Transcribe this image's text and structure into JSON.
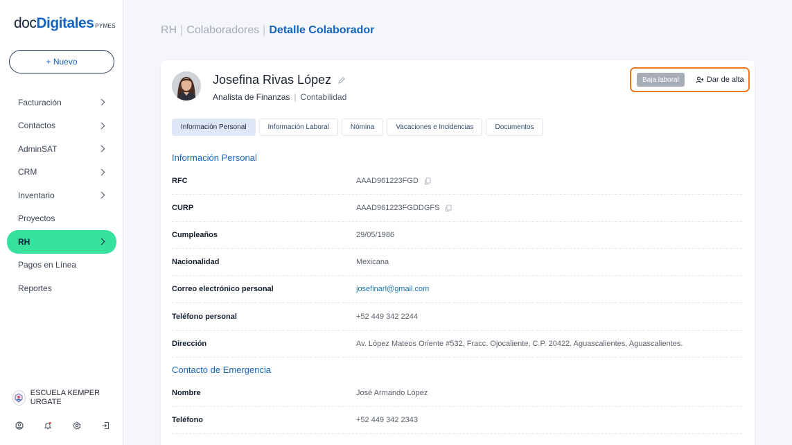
{
  "brand": {
    "doc": "doc",
    "digitales": "Digitales",
    "pymes": "PYMES"
  },
  "new_button": "+ Nuevo",
  "sidebar": {
    "items": [
      {
        "label": "Facturación",
        "chevron": true,
        "active": false
      },
      {
        "label": "Contactos",
        "chevron": true,
        "active": false
      },
      {
        "label": "AdminSAT",
        "chevron": true,
        "active": false
      },
      {
        "label": "CRM",
        "chevron": true,
        "active": false
      },
      {
        "label": "Inventario",
        "chevron": true,
        "active": false
      },
      {
        "label": "Proyectos",
        "chevron": false,
        "active": false
      },
      {
        "label": "RH",
        "chevron": true,
        "active": true
      },
      {
        "label": "Pagos en Línea",
        "chevron": false,
        "active": false
      },
      {
        "label": "Reportes",
        "chevron": false,
        "active": false
      }
    ],
    "org_name": "ESCUELA KEMPER URGATE",
    "footer_icons": [
      "user-icon",
      "bell-icon",
      "gear-icon",
      "logout-icon"
    ]
  },
  "breadcrumb": {
    "items": [
      "RH",
      "Colaboradores"
    ],
    "separator": "|",
    "current": "Detalle Colaborador"
  },
  "employee": {
    "name": "Josefina Rivas López",
    "position": "Analista de Finanzas",
    "separator": "|",
    "department": "Contabilidad"
  },
  "actions": {
    "baja": "Baja laboral",
    "alta": "Dar de alta"
  },
  "tabs": [
    "Información Personal",
    "Información Laboral",
    "Nómina",
    "Vacaciones e Incidencias",
    "Documentos"
  ],
  "active_tab": 0,
  "personal": {
    "title": "Información Personal",
    "rows": [
      {
        "label": "RFC",
        "value": "AAAD961223FGD",
        "copy": true
      },
      {
        "label": "CURP",
        "value": "AAAD961223FGDDGFS",
        "copy": true
      },
      {
        "label": "Cumpleaños",
        "value": "29/05/1986"
      },
      {
        "label": "Nacionalidad",
        "value": "Mexicana"
      },
      {
        "label": "Correo electrónico personal",
        "value": "josefinarl@gmail.com",
        "link": true
      },
      {
        "label": "Teléfono personal",
        "value": "+52 449 342 2244"
      },
      {
        "label": "Dirección",
        "value": "Av. López Mateos Oriente #532, Fracc. Ojocaliente, C.P. 20422. Aguascalientes, Aguascalientes."
      }
    ]
  },
  "emergency": {
    "title": "Contacto de Emergencia",
    "rows": [
      {
        "label": "Nombre",
        "value": "José Armando López"
      },
      {
        "label": "Teléfono",
        "value": "+52 449 342 2343"
      }
    ]
  },
  "colors": {
    "accent": "#1565c0",
    "active_nav": "#37e29e",
    "highlight_border": "#ea7a24",
    "link": "#1a7ab5"
  }
}
